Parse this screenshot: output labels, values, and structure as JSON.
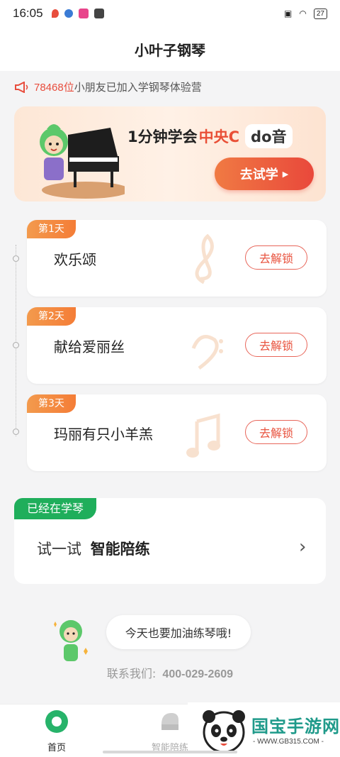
{
  "status": {
    "time": "16:05",
    "battery": "27"
  },
  "header": {
    "title": "小叶子钢琴"
  },
  "notice": {
    "count": "78468位",
    "text": "小朋友已加入学钢琴体验营"
  },
  "banner": {
    "headline_prefix": "1分钟学会",
    "headline_highlight": "中央C",
    "headline_badge": "do音",
    "cta_label": "去试学"
  },
  "lessons": [
    {
      "tag": "第1天",
      "title": "欢乐颂",
      "button": "去解锁"
    },
    {
      "tag": "第2天",
      "title": "献给爱丽丝",
      "button": "去解锁"
    },
    {
      "tag": "第3天",
      "title": "玛丽有只小羊羔",
      "button": "去解锁"
    }
  ],
  "practice": {
    "tag": "已经在学琴",
    "lead": "试一试",
    "feature": "智能陪练"
  },
  "cheer": "今天也要加油练琴哦!",
  "contact": {
    "label": "联系我们:",
    "phone": "400-029-2609"
  },
  "tabs": [
    {
      "label": "首页"
    },
    {
      "label": "智能陪练"
    }
  ],
  "watermark": {
    "title": "国宝手游网",
    "url": "- WWW.GB315.COM -"
  },
  "colors": {
    "accent": "#e94f36",
    "green": "#1fae5b",
    "tag_orange": "#f47d37"
  }
}
